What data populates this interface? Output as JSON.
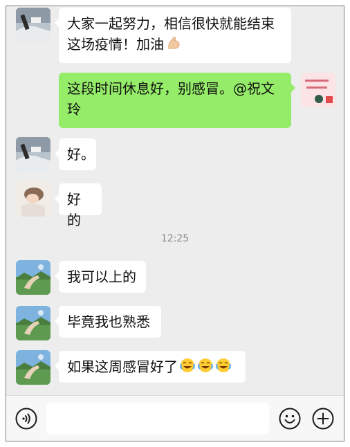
{
  "messages": [
    {
      "sender": "left",
      "avatar_icon": "car-avatar-icon",
      "lines": [
        "大家一起努力，相信很快就能结束",
        "这场疫情！加油"
      ],
      "trailing_emoji": "flexed-biceps-emoji"
    },
    {
      "sender": "right",
      "avatar_icon": "sticker-avatar-icon",
      "lines": [
        "这段时间休息好，别感冒。@祝文",
        "玲"
      ]
    },
    {
      "sender": "left",
      "avatar_icon": "car-avatar-icon",
      "lines": [
        "好。"
      ]
    },
    {
      "sender": "left",
      "avatar_icon": "girl-avatar-icon",
      "lines": [
        "好的"
      ]
    },
    {
      "sender": "left",
      "avatar_icon": "landscape-avatar-icon",
      "lines": [
        "我可以上的"
      ]
    },
    {
      "sender": "left",
      "avatar_icon": "landscape-avatar-icon",
      "lines": [
        "毕竟我也熟悉"
      ]
    },
    {
      "sender": "left",
      "avatar_icon": "landscape-avatar-icon",
      "lines": [
        "如果这周感冒好了"
      ],
      "trailing_emoji": "crying-laughing-emoji",
      "trailing_emoji_count": 3
    }
  ],
  "timestamp": "12:25",
  "input_bar": {
    "voice_icon": "voice-icon",
    "emoji_icon": "smiley-icon",
    "plus_icon": "plus-icon",
    "input_value": ""
  },
  "colors": {
    "chat_background": "#ededed",
    "left_bubble": "#ffffff",
    "right_bubble": "#95ec69",
    "timestamp_text": "#8a8a8a"
  }
}
